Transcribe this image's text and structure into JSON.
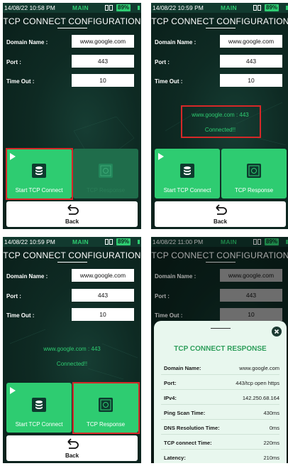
{
  "common": {
    "title": "TCP CONNECT CONFIGURATION",
    "mode": "MAIN",
    "battery": "89%",
    "domain_label": "Domain Name :",
    "port_label": "Port :",
    "timeout_label": "Time Out :",
    "domain_value": "www.google.com",
    "port_value": "443",
    "timeout_value": "10",
    "start_label": "Start TCP Connect",
    "response_label": "TCP Response",
    "back_label": "Back",
    "status_host": "www.google.com : 443",
    "status_connected": "Connected!!"
  },
  "panels": [
    {
      "time": "14/08/22 10:58 PM"
    },
    {
      "time": "14/08/22 10:59 PM"
    },
    {
      "time": "14/08/22 10:59 PM"
    },
    {
      "time": "14/08/22 11:00 PM"
    }
  ],
  "response": {
    "title": "TCP CONNECT RESPONSE",
    "rows": [
      {
        "label": "Domain Name:",
        "value": "www.google.com"
      },
      {
        "label": "Port:",
        "value": "443/tcp open  https"
      },
      {
        "label": "IPv4:",
        "value": "142.250.68.164"
      },
      {
        "label": "Ping Scan Time:",
        "value": "430ms"
      },
      {
        "label": "DNS Resolution Time:",
        "value": "0ms"
      },
      {
        "label": "TCP connect Time:",
        "value": "220ms"
      },
      {
        "label": "Latency:",
        "value": "210ms"
      }
    ]
  },
  "colors": {
    "accent_green": "#2ecc71",
    "background": "#0e2a23",
    "highlight_red": "#d62828"
  },
  "icons": [
    "link-icon",
    "play-icon",
    "database-icon",
    "tcp-response-icon",
    "back-arrow-icon",
    "close-icon"
  ]
}
